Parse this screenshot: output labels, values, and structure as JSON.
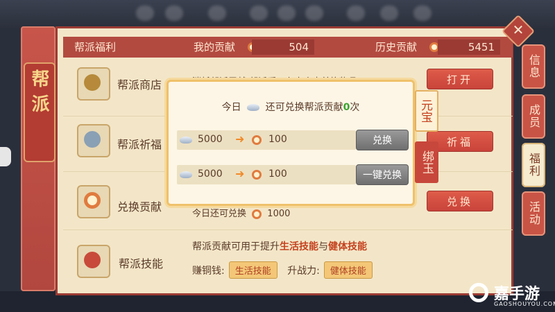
{
  "guild_tab": {
    "label": "帮派"
  },
  "header": {
    "tab_label": "帮派福利",
    "my_contribution_label": "我的贡献",
    "my_contribution_value": "504",
    "history_label": "历史贡献",
    "history_value": "5451"
  },
  "rows": [
    {
      "title": "帮派商店",
      "desc": "消耗帮派贡献,帮派币可在商店中兑换物品",
      "button": "打开"
    },
    {
      "title": "帮派祈福",
      "desc": "",
      "button": "祈福"
    },
    {
      "title": "兑换贡献",
      "desc_prefix": "今日还可兑换",
      "desc_value": "1000",
      "button": "兑换"
    }
  ],
  "skills": {
    "title": "帮派技能",
    "line1_prefix": "帮派贡献可用于提升",
    "line1_hl1": "生活技能",
    "line1_mid": "与",
    "line1_hl2": "健体技能",
    "earn_label": "赚铜钱:",
    "earn_chip": "生活技能",
    "power_label": "升战力:",
    "power_chip": "健体技能"
  },
  "side_tabs": [
    {
      "label": "信息",
      "active": false
    },
    {
      "label": "成员",
      "active": false
    },
    {
      "label": "福利",
      "active": true
    },
    {
      "label": "活动",
      "active": false
    }
  ],
  "modal": {
    "title_prefix": "今日",
    "title_mid": "还可兑换帮派贡献",
    "title_count": "0",
    "title_suffix": "次",
    "rows": [
      {
        "cost": "5000",
        "gain": "100",
        "button": "兑换"
      },
      {
        "cost": "5000",
        "gain": "100",
        "button": "一键兑换"
      }
    ],
    "ribbons": [
      {
        "label": "元宝",
        "active": true
      },
      {
        "label": "绑玉",
        "active": false
      }
    ]
  },
  "watermark": {
    "brand": "嘉手游",
    "site": "GAOSHOUYOU.COM"
  },
  "icons": [
    "close-icon",
    "coin-icon",
    "silver-ingot-icon",
    "arrow-right-icon"
  ],
  "colors": {
    "accent": "#c85446",
    "panel": "#f3e6c8",
    "highlight": "#c4421f",
    "count_green": "#3aa32e"
  }
}
